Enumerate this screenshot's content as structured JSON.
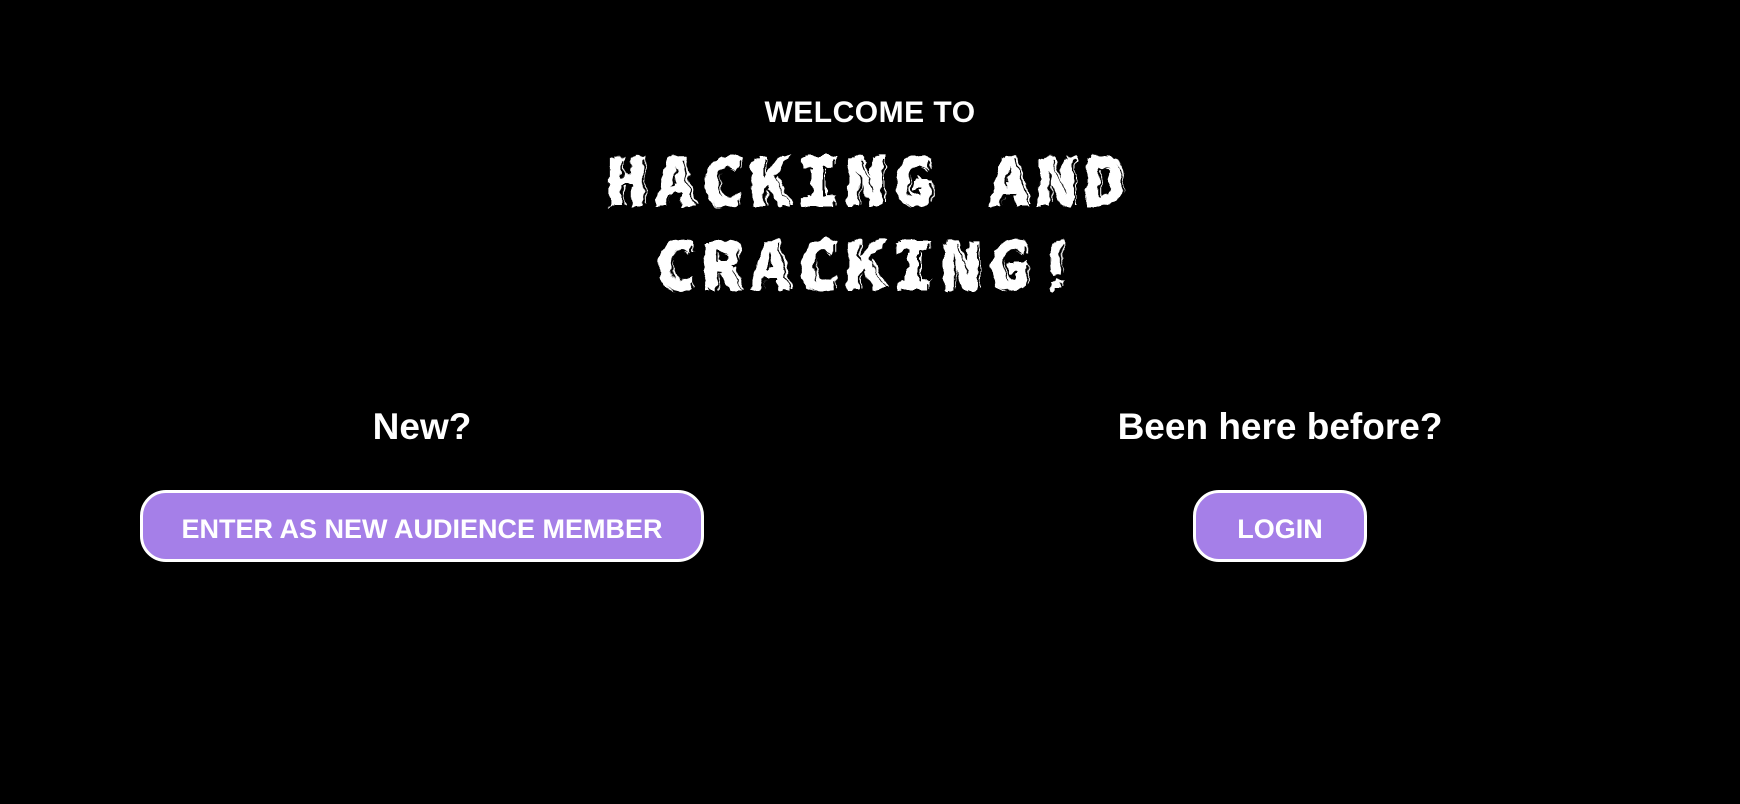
{
  "header": {
    "welcome": "WELCOME TO",
    "title_line1": "HACKING AND",
    "title_line2": "CRACKING!"
  },
  "new_user": {
    "prompt": "New?",
    "button_label": "ENTER AS NEW AUDIENCE MEMBER"
  },
  "returning_user": {
    "prompt": "Been here before?",
    "button_label": "LOGIN"
  },
  "colors": {
    "background": "#000000",
    "button_fill": "#a57fe8",
    "button_border": "#ffffff",
    "text": "#ffffff"
  }
}
